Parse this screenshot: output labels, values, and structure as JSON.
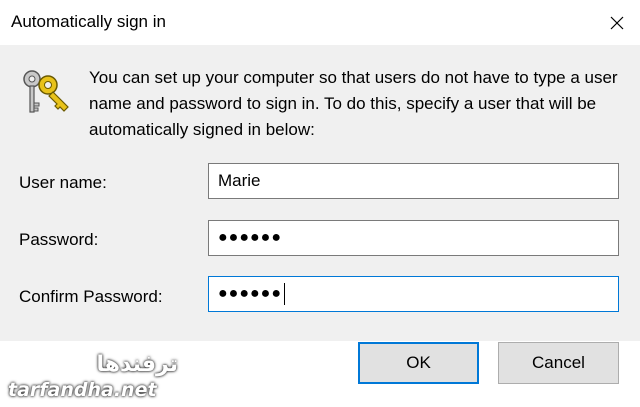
{
  "window": {
    "title": "Automatically sign in",
    "close_icon": "close-icon"
  },
  "dialog": {
    "icon": "keys-icon",
    "description": "You can set up your computer so that users do not have to type a user name and password to sign in. To do this, specify a user that will be automatically signed in below:",
    "fields": {
      "username_label": "User name:",
      "username_value": "Marie",
      "password_label": "Password:",
      "password_value": "●●●●●●",
      "confirm_label": "Confirm Password:",
      "confirm_value": "●●●●●●"
    }
  },
  "buttons": {
    "ok_label": "OK",
    "cancel_label": "Cancel"
  },
  "watermark": {
    "arabic": "ترفندها",
    "latin": "tarfandha.net"
  }
}
